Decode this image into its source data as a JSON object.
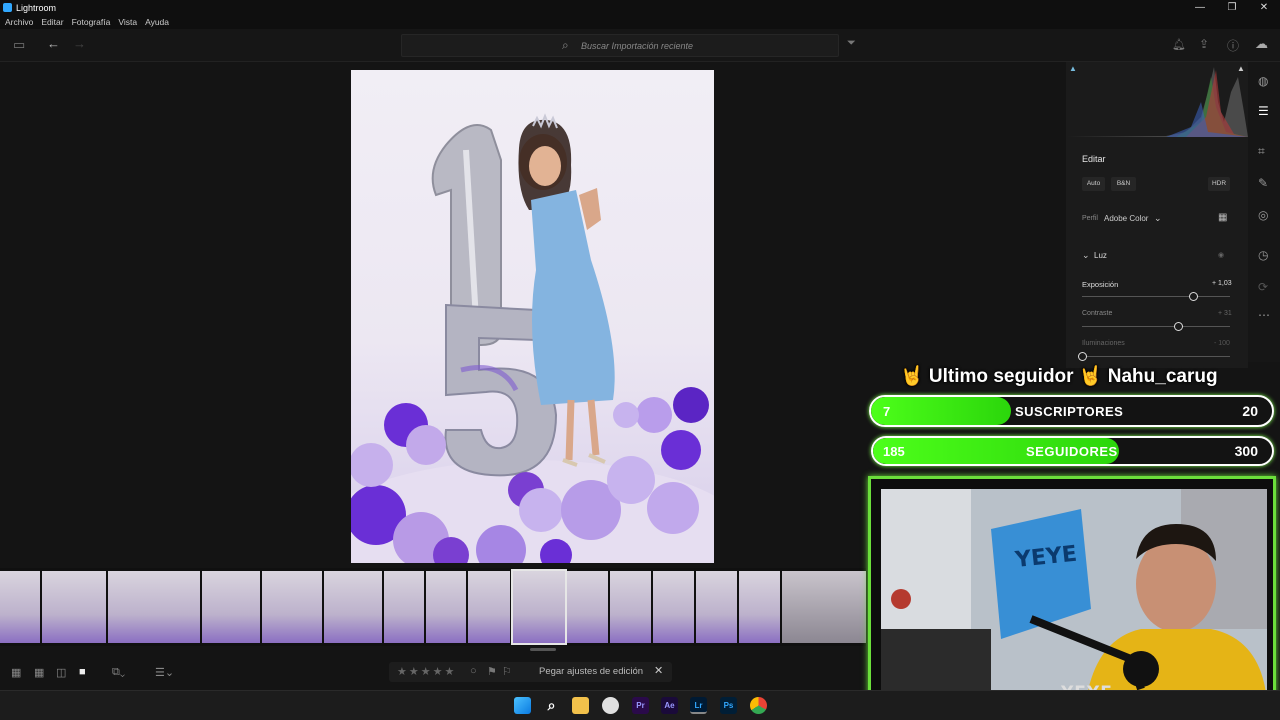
{
  "window": {
    "title": "Lightroom",
    "minimize": "—",
    "maximize": "❐",
    "close": "✕"
  },
  "menu": [
    "Archivo",
    "Editar",
    "Fotografía",
    "Vista",
    "Ayuda"
  ],
  "search": {
    "placeholder": "Buscar Importación reciente"
  },
  "edit_panel": {
    "title": "Editar",
    "buttons": [
      "Auto",
      "B&N",
      "HDR"
    ],
    "profile_label": "Perfil",
    "profile_value": "Adobe Color",
    "section": "Luz",
    "sliders": [
      {
        "label": "Exposición",
        "value": "+ 1,03",
        "level": 0.75
      },
      {
        "label": "Contraste",
        "value": "+ 31",
        "level": 0.65
      },
      {
        "label": "Iluminaciones",
        "value": "- 100",
        "level": 0.0
      }
    ]
  },
  "bottom": {
    "paste_label": "Pegar ajustes de edición",
    "stars": "★★★★★"
  },
  "overlay": {
    "follower_text": "🤘 Ultimo seguidor 🤘 Nahu_carug",
    "subs": {
      "current": "7",
      "label": "SUSCRIPTORES",
      "goal": "20",
      "progress": 0.35
    },
    "followers": {
      "current": "185",
      "label": "SEGUIDORES",
      "goal": "300",
      "progress": 0.617
    },
    "cam_brand": "YEYE",
    "wall_text": "YEYE"
  },
  "taskbar": {
    "icons": [
      "windows-start",
      "search",
      "file-explorer",
      "chrome-canary",
      "premiere-pro",
      "after-effects",
      "lightroom",
      "photoshop",
      "chrome"
    ],
    "labels": {
      "pr": "Pr",
      "ae": "Ae",
      "lr": "Lr",
      "ps": "Ps"
    }
  },
  "colors": {
    "accent_green": "#4dff1a",
    "lr_blue": "#31a8ff",
    "balloon_purple": "#7a3fd1"
  }
}
